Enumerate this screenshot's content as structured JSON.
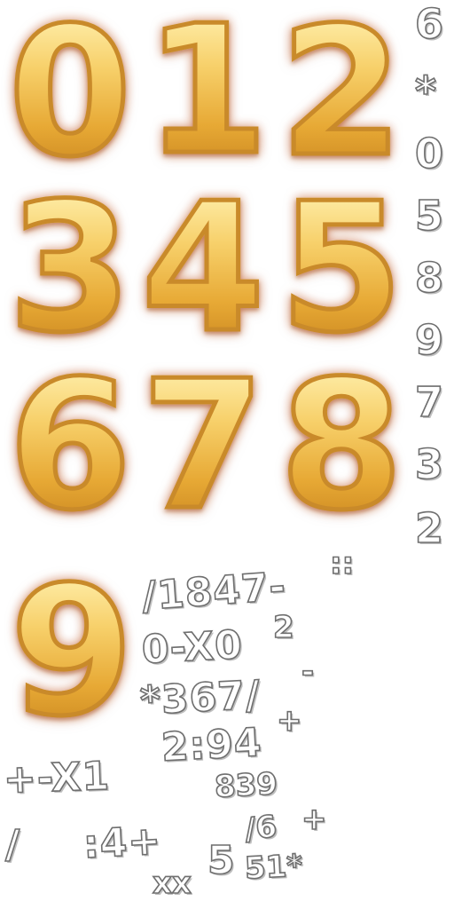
{
  "gold_digits": [
    "0",
    "1",
    "2",
    "3",
    "4",
    "5",
    "6",
    "7",
    "8",
    "9"
  ],
  "white_column": [
    "6",
    "*",
    "0",
    "5",
    "8",
    "9",
    "7",
    "3",
    "2"
  ],
  "glyph_rows": {
    "row1": "/1847-",
    "row1_tail": "::",
    "row2": "0-X0",
    "row2_sup": "2",
    "row3": "*367/",
    "row3_tail": "-",
    "row4a": "2:94",
    "row4a_tail": "+",
    "row4b": "+-X1",
    "row4c": "839",
    "row5a": "/",
    "row5b": ":4+",
    "row5c": "/6",
    "row5c_tail": "+",
    "row5d": "5",
    "row5e": "51*",
    "row5f": "xx"
  },
  "colors": {
    "gold_light": "#fff1b0",
    "gold_mid": "#f7d06a",
    "gold_dark": "#c9851e",
    "glow": "#c85a28",
    "white_glyph": "#ffffff",
    "glyph_outline": "#6f6f6f"
  }
}
